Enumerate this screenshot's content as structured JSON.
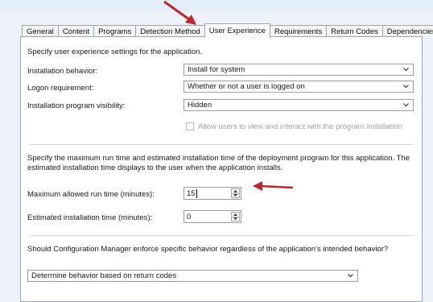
{
  "tabs": [
    {
      "label": "General"
    },
    {
      "label": "Content"
    },
    {
      "label": "Programs"
    },
    {
      "label": "Detection Method"
    },
    {
      "label": "User Experience",
      "active": true
    },
    {
      "label": "Requirements"
    },
    {
      "label": "Return Codes"
    },
    {
      "label": "Dependencies"
    }
  ],
  "intro": "Specify user experience settings for the application.",
  "fields": {
    "installation_behavior": {
      "label": "Installation behavior:",
      "value": "Install for system"
    },
    "logon_requirement": {
      "label": "Logon requirement:",
      "value": "Whether or not a user is logged on"
    },
    "visibility": {
      "label": "Installation program visibility:",
      "value": "Hidden"
    },
    "allow_interact": {
      "label": "Allow users to view and interact with the program installation",
      "checked": false
    }
  },
  "runtime_description": "Specify the maximum run time and estimated installation time of the deployment program for this application. The estimated installation time displays to the user when the application installs.",
  "max_runtime": {
    "label": "Maximum allowed run time (minutes):",
    "value": "15"
  },
  "est_time": {
    "label": "Estimated installation time (minutes):",
    "value": "0"
  },
  "enforce_question": "Should Configuration Manager enforce specific behavior regardless of the application’s intended behavior?",
  "enforce_behavior": {
    "value": "Determine behavior based on return codes"
  },
  "colors": {
    "annotation_arrow": "#c0262b",
    "tab_border": "#9aa7b6",
    "panel_background": "#ffffff"
  },
  "icons": {
    "dropdown": "chevron-down-icon",
    "spinner": "spin-up-down-icon",
    "annotation": "red-arrow"
  }
}
